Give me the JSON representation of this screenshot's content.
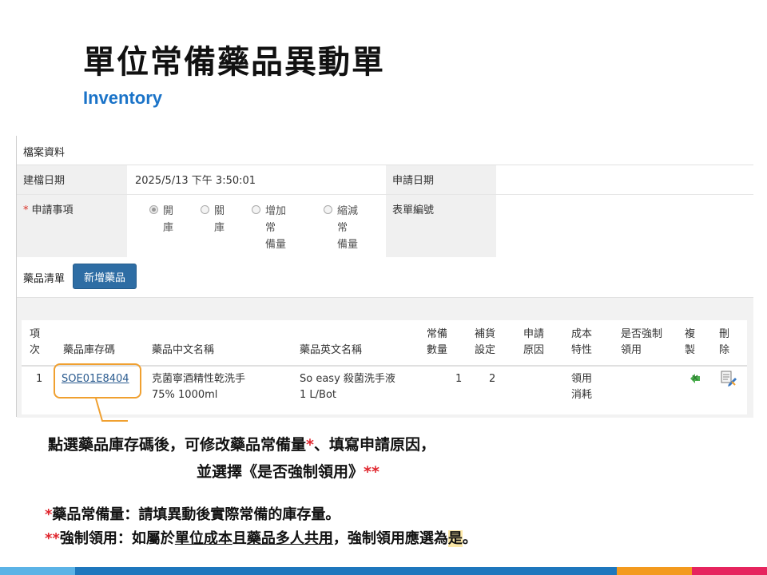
{
  "slide": {
    "title": "單位常備藥品異動單",
    "subtitle": "Inventory"
  },
  "form": {
    "section_title": "檔案資料",
    "created_date_label": "建檔日期",
    "created_date_value": "2025/5/13 下午 3:50:01",
    "apply_date_label": "申請日期",
    "apply_date_value": "",
    "apply_item_label": "申請事項",
    "required_mark": "*",
    "form_no_label": "表單編號",
    "form_no_value": "",
    "radio_options": [
      {
        "label": "開庫",
        "line1": "開",
        "line2": "庫",
        "checked": true
      },
      {
        "label": "關庫",
        "line1": "關",
        "line2": "庫",
        "checked": false
      },
      {
        "label": "增加常備量",
        "line1": "增加常",
        "line2": "備量",
        "checked": false
      },
      {
        "label": "縮減常備量",
        "line1": "縮減常",
        "line2": "備量",
        "checked": false
      }
    ]
  },
  "drug_list": {
    "title": "藥品清單",
    "add_button": "新增藥品",
    "columns": {
      "index": [
        "項",
        "次"
      ],
      "code": "藥品庫存碼",
      "name_zh": "藥品中文名稱",
      "name_en": "藥品英文名稱",
      "stock": [
        "常備",
        "數量"
      ],
      "refill": [
        "補貨",
        "設定"
      ],
      "reason": [
        "申請",
        "原因"
      ],
      "cost": [
        "成本",
        "特性"
      ],
      "force": [
        "是否強制",
        "領用"
      ],
      "copy": [
        "複",
        "製"
      ],
      "delete": [
        "刪",
        "除"
      ]
    },
    "rows": [
      {
        "index": "1",
        "code": "SOE01E8404",
        "name_zh_1": "克菌寧酒精性乾洗手",
        "name_zh_2": "75% 1000ml",
        "name_en_1": "So easy 殺菌洗手液",
        "name_en_2": "1 L/Bot",
        "stock": "1",
        "refill": "2",
        "reason": "",
        "cost_1": "領用",
        "cost_2": "消耗",
        "force": ""
      }
    ],
    "copy_icon": "copy-icon",
    "delete_icon": "edit-delete-icon"
  },
  "callout": {
    "line1_a": "點選藥品庫存碼後，可修改藥品常備量",
    "line1_star": "*",
    "line1_b": "、填寫申請原因，",
    "line2_a": "並選擇《是否強制領用》",
    "line2_star": "**"
  },
  "notes": {
    "n1_star": "*",
    "n1_text": "藥品常備量：請填異動後實際常備的庫存量。",
    "n2_star": "**",
    "n2_a": "強制領用：如屬於",
    "n2_u1": "單位成本",
    "n2_b": "且",
    "n2_u2": "藥品多人共用",
    "n2_c": "，強制領用應選為",
    "n2_hl": "是",
    "n2_d": "。"
  },
  "colors": {
    "accent": "#1a73c8",
    "button": "#2e6da4",
    "highlight_border": "#f0a030",
    "red": "#e0262e",
    "bar_light_blue": "#5bb3e6",
    "bar_blue": "#1e77bd",
    "bar_orange": "#f39a1e",
    "bar_pink": "#e6245e"
  }
}
